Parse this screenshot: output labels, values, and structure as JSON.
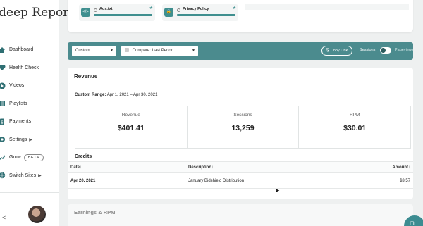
{
  "brand": {
    "title": "deep Report"
  },
  "sidebar": {
    "items": [
      {
        "label": "Dashboard",
        "icon": "home-icon"
      },
      {
        "label": "Health Check",
        "icon": "heart-icon"
      },
      {
        "label": "Videos",
        "icon": "play-icon"
      },
      {
        "label": "Playlists",
        "icon": "list-icon"
      },
      {
        "label": "Payments",
        "icon": "dollar-icon"
      },
      {
        "label": "Settings",
        "icon": "gear-icon"
      },
      {
        "label": "Grow",
        "icon": "grow-icon",
        "badge": "BETA"
      },
      {
        "label": "Switch Sites",
        "icon": "globe-icon"
      }
    ],
    "collapse_glyph": "<"
  },
  "tools": [
    {
      "name": "Ads.txt",
      "icon": "code-icon"
    },
    {
      "name": "Privacy Policy",
      "icon": "lock-icon"
    }
  ],
  "filter": {
    "range_value": "Custom",
    "compare_value": "Compare: Last Period",
    "copy_link_label": "Copy Link",
    "toggle_left": "Sessions",
    "toggle_right": "Pageviews",
    "accent": "#4b8b8e"
  },
  "revenue": {
    "title": "Revenue",
    "range_label": "Custom Range:",
    "range_value": "Apr 1, 2021 – Apr 30, 2021",
    "metrics": [
      {
        "label": "Revenue",
        "value": "$401.41"
      },
      {
        "label": "Sessions",
        "value": "13,259"
      },
      {
        "label": "RPM",
        "value": "$30.01"
      }
    ],
    "credits": {
      "title": "Credits",
      "columns": [
        "Date",
        "Description",
        "Amount"
      ],
      "rows": [
        {
          "date": "Apr 20, 2021",
          "description": "January Bidshield Distribution",
          "amount": "$3.57"
        }
      ]
    }
  },
  "earnings": {
    "title": "Earnings & RPM"
  }
}
